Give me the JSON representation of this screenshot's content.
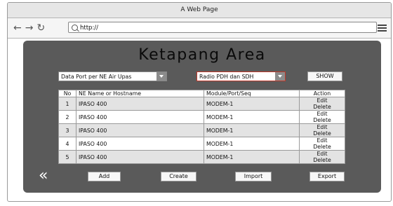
{
  "window": {
    "title": "A Web Page"
  },
  "browser": {
    "url": "http://",
    "nav_icons": {
      "back": "←",
      "forward": "→",
      "reload": "↻"
    }
  },
  "page": {
    "title": "Ketapang Area",
    "filters": {
      "data_port_selected": "Data Port per NE Air Upas",
      "radio_selected": "Radio PDH dan SDH",
      "show_label": "SHOW"
    },
    "table": {
      "headers": [
        "No",
        "NE Name or Hostname",
        "Module/Port/Seq",
        "Action"
      ],
      "rows": [
        {
          "no": "1",
          "ne_name": "IPASO 400",
          "module": "MODEM-1",
          "edit": "Edit",
          "delete": "Delete"
        },
        {
          "no": "2",
          "ne_name": "IPASO 400",
          "module": "MODEM-1",
          "edit": "Edit",
          "delete": "Delete"
        },
        {
          "no": "3",
          "ne_name": "IPASO 400",
          "module": "MODEM-1",
          "edit": "Edit",
          "delete": "Delete"
        },
        {
          "no": "4",
          "ne_name": "IPASO 400",
          "module": "MODEM-1",
          "edit": "Edit",
          "delete": "Delete"
        },
        {
          "no": "5",
          "ne_name": "IPASO 400",
          "module": "MODEM-1",
          "edit": "Edit",
          "delete": "Delete"
        }
      ]
    },
    "actions": {
      "back_glyph": "«",
      "add": "Add",
      "create": "Create",
      "import": "Import",
      "export": "Export"
    }
  }
}
